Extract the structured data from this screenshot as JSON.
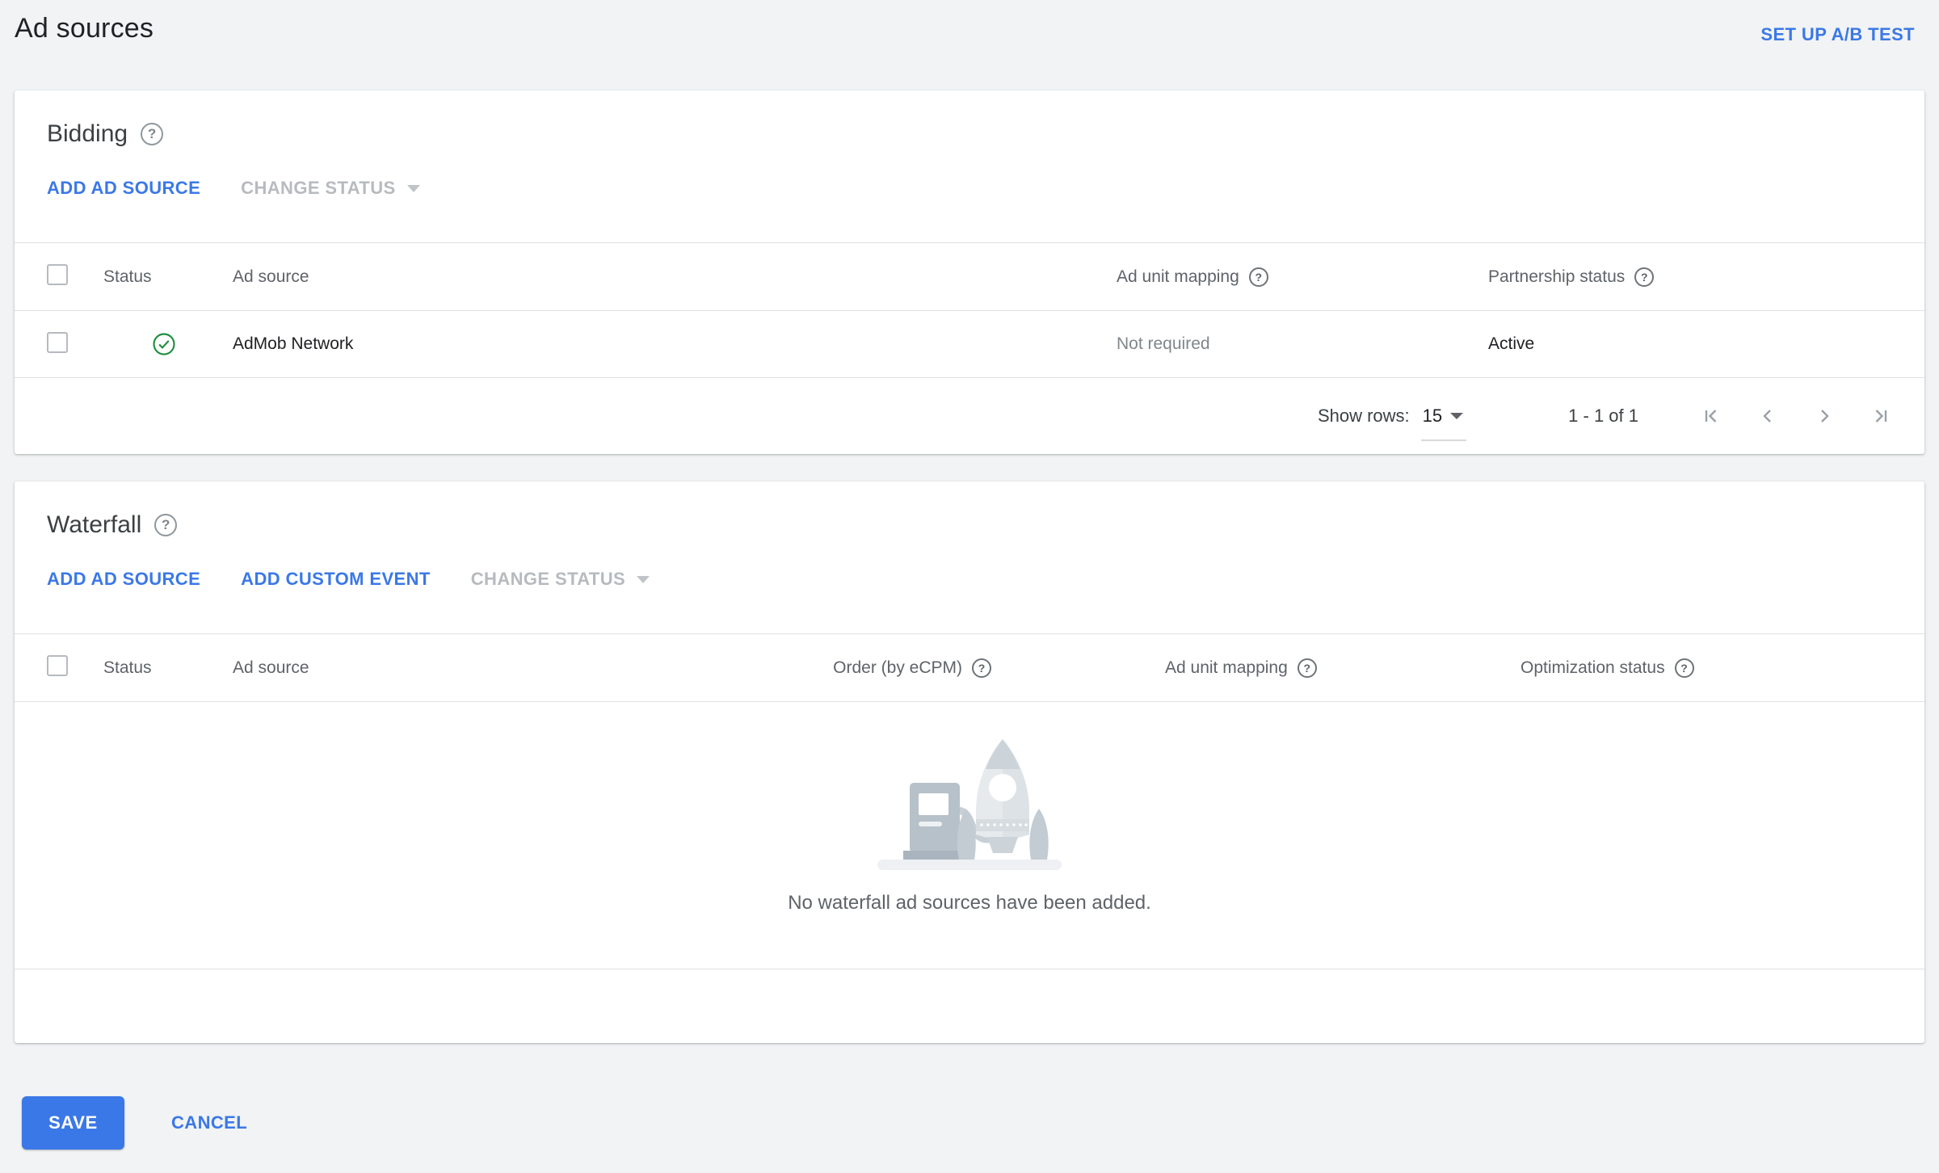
{
  "page": {
    "title": "Ad sources",
    "setup_ab_test_label": "SET UP A/B TEST"
  },
  "icons": {
    "help_glyph": "?"
  },
  "bidding": {
    "title": "Bidding",
    "actions": {
      "add_ad_source": "ADD AD SOURCE",
      "change_status": "CHANGE STATUS"
    },
    "table": {
      "headers": {
        "status": "Status",
        "ad_source": "Ad source",
        "ad_unit_mapping": "Ad unit mapping",
        "partnership_status": "Partnership status"
      },
      "rows": [
        {
          "status_icon": "check-circle",
          "ad_source": "AdMob Network",
          "ad_unit_mapping": "Not required",
          "partnership_status": "Active"
        }
      ]
    },
    "pagination": {
      "show_rows_label": "Show rows:",
      "rows_per_page": "15",
      "range_label": "1 - 1 of 1"
    }
  },
  "waterfall": {
    "title": "Waterfall",
    "actions": {
      "add_ad_source": "ADD AD SOURCE",
      "add_custom_event": "ADD CUSTOM EVENT",
      "change_status": "CHANGE STATUS"
    },
    "table": {
      "headers": {
        "status": "Status",
        "ad_source": "Ad source",
        "order": "Order (by eCPM)",
        "ad_unit_mapping": "Ad unit mapping",
        "optimization_status": "Optimization status"
      }
    },
    "empty_state": {
      "message": "No waterfall ad sources have been added.",
      "illustration": "rocket-and-fuel-pump"
    }
  },
  "footer": {
    "save_label": "SAVE",
    "cancel_label": "CANCEL"
  },
  "colors": {
    "link_blue": "#3b78e7",
    "save_button_blue": "#3b78e7",
    "success_green": "#1e8e3e",
    "page_bg": "#f1f3f4",
    "card_bg": "#ffffff",
    "divider": "#e0e0e0",
    "text_primary": "#202124",
    "text_secondary": "#5f6368",
    "text_disabled": "#b7babe"
  }
}
